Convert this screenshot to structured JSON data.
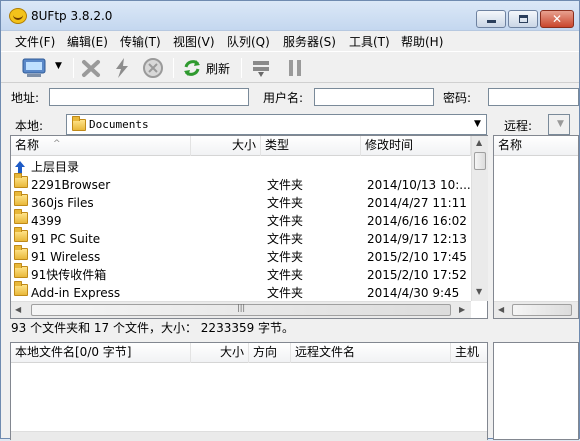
{
  "window": {
    "title": "8UFtp 3.8.2.0",
    "close_glyph": "✕"
  },
  "menu": [
    "文件(F)",
    "编辑(E)",
    "传输(T)",
    "视图(V)",
    "队列(Q)",
    "服务器(S)",
    "工具(T)",
    "帮助(H)"
  ],
  "toolbar": {
    "refresh_label": "刷新"
  },
  "connect": {
    "address_label": "地址:",
    "username_label": "用户名:",
    "password_label": "密码:",
    "address_value": "",
    "username_value": "",
    "password_value": ""
  },
  "local": {
    "label": "本地:",
    "path": "Documents",
    "columns": {
      "name": "名称",
      "size": "大小",
      "type": "类型",
      "modified": "修改时间"
    },
    "parent_dir": "上层目录",
    "files": [
      {
        "name": "2291Browser",
        "type": "文件夹",
        "modified": "2014/10/13 10:..."
      },
      {
        "name": "360js Files",
        "type": "文件夹",
        "modified": "2014/4/27 11:11"
      },
      {
        "name": "4399",
        "type": "文件夹",
        "modified": "2014/6/16 16:02"
      },
      {
        "name": "91 PC Suite",
        "type": "文件夹",
        "modified": "2014/9/17 12:13"
      },
      {
        "name": "91 Wireless",
        "type": "文件夹",
        "modified": "2015/2/10 17:45"
      },
      {
        "name": "91快传收件箱",
        "type": "文件夹",
        "modified": "2015/2/10 17:52"
      },
      {
        "name": "Add-in Express",
        "type": "文件夹",
        "modified": "2014/4/30 9:45"
      }
    ],
    "status": "93 个文件夹和 17 个文件，大小： 2233359 字节。"
  },
  "remote": {
    "label": "远程:",
    "columns": {
      "name": "名称"
    }
  },
  "queue": {
    "columns": {
      "local": "本地文件名[0/0 字节]",
      "size": "大小",
      "direction": "方向",
      "remote": "远程文件名",
      "host": "主机"
    }
  },
  "icons": {
    "dropdown": "▼",
    "scroll_up": "▲",
    "scroll_down": "▼",
    "scroll_left": "◀",
    "scroll_right": "▶",
    "scroll_grip": "|||",
    "sort": "^"
  }
}
